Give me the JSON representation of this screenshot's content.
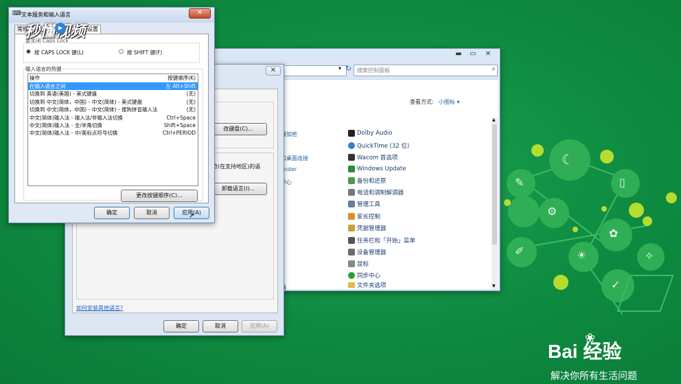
{
  "control_panel": {
    "search_placeholder": "搜索控制面板",
    "view_by_label": "查看方式:",
    "view_by_value": "小图标 ▾",
    "left_fragments": [
      "器加密",
      "和桌面连接",
      "ender",
      "中心",
      "器"
    ],
    "items": [
      {
        "label": "Dolby Audio",
        "icon": "dolby-icon",
        "color": "#222222"
      },
      {
        "label": "QuickTime (32 位)",
        "icon": "quicktime-icon",
        "color": "#3a7bd5"
      },
      {
        "label": "Wacom 首选项",
        "icon": "wacom-icon",
        "color": "#333333"
      },
      {
        "label": "Windows Update",
        "icon": "windows-update-icon",
        "color": "#2e8b3a"
      },
      {
        "label": "备份和还原",
        "icon": "backup-icon",
        "color": "#4a9b4a"
      },
      {
        "label": "电话和调制解调器",
        "icon": "phone-icon",
        "color": "#777777"
      },
      {
        "label": "管理工具",
        "icon": "admin-tools-icon",
        "color": "#6b7d99"
      },
      {
        "label": "家长控制",
        "icon": "parental-control-icon",
        "color": "#d9902a"
      },
      {
        "label": "凭据管理器",
        "icon": "credential-icon",
        "color": "#c7a03c"
      },
      {
        "label": "任务栏和「开始」菜单",
        "icon": "taskbar-icon",
        "color": "#555555"
      },
      {
        "label": "设备管理器",
        "icon": "device-manager-icon",
        "color": "#6b6b6b"
      },
      {
        "label": "鼠标",
        "icon": "mouse-icon",
        "color": "#888888"
      },
      {
        "label": "同步中心",
        "icon": "sync-icon",
        "color": "#2e9e3a"
      },
      {
        "label": "文件夹选项",
        "icon": "folder-icon",
        "color": "#e0b74a"
      }
    ]
  },
  "region_dialog": {
    "change_keyboard_button": "改键盘(C)...",
    "fragment_text": "符(在支持地区)的语",
    "uninstall_language_button": "卸载语言(I)...",
    "install_link": "如何安装其他语言?",
    "ok": "确定",
    "cancel": "取消",
    "apply": "应用(A)"
  },
  "text_services": {
    "title": "文本服务和输入语言",
    "tab_visible": "常规",
    "tab_partial": "键设置",
    "caps_group_label": "要关闭 Caps Lock",
    "caps_option": "按 CAPS LOCK 键(L)",
    "shift_option": "按 SHIFT 键(F)",
    "hotkeys_group_label": "输入语言的热键",
    "col_action": "操作",
    "col_key": "按键顺序(K)",
    "rows": [
      {
        "action": "在输入语言之间",
        "key": "左 Alt+Shift"
      },
      {
        "action": "切换到 英语(美国) - 美式键盘",
        "key": "(无)"
      },
      {
        "action": "切换到 中文(简体，中国) - 中文(简体) - 美式键盘",
        "key": "(无)"
      },
      {
        "action": "切换到 中文(简体，中国) - 中文(简体) - 搜狗拼音输入法",
        "key": "(无)"
      },
      {
        "action": "中文(简体)输入法 - 输入法/非输入法切换",
        "key": "Ctrl+Space"
      },
      {
        "action": "中文(简体)输入法 - 全/半角切换",
        "key": "Shift+Space"
      },
      {
        "action": "中文(简体)输入法 - 中/英标点符号切换",
        "key": "Ctrl+PERIOD"
      }
    ],
    "change_sequence_button": "更改按键顺序(C)...",
    "ok": "确定",
    "cancel": "取消",
    "apply": "应用(A)"
  },
  "watermark": {
    "brand": "秒懂视频",
    "baidu_logo": "Bai 经验",
    "slogan": "解决你所有生活问题"
  },
  "colors": {
    "background": "#0f8a42",
    "selection": "#3399ff",
    "link": "#1a5e9e"
  }
}
